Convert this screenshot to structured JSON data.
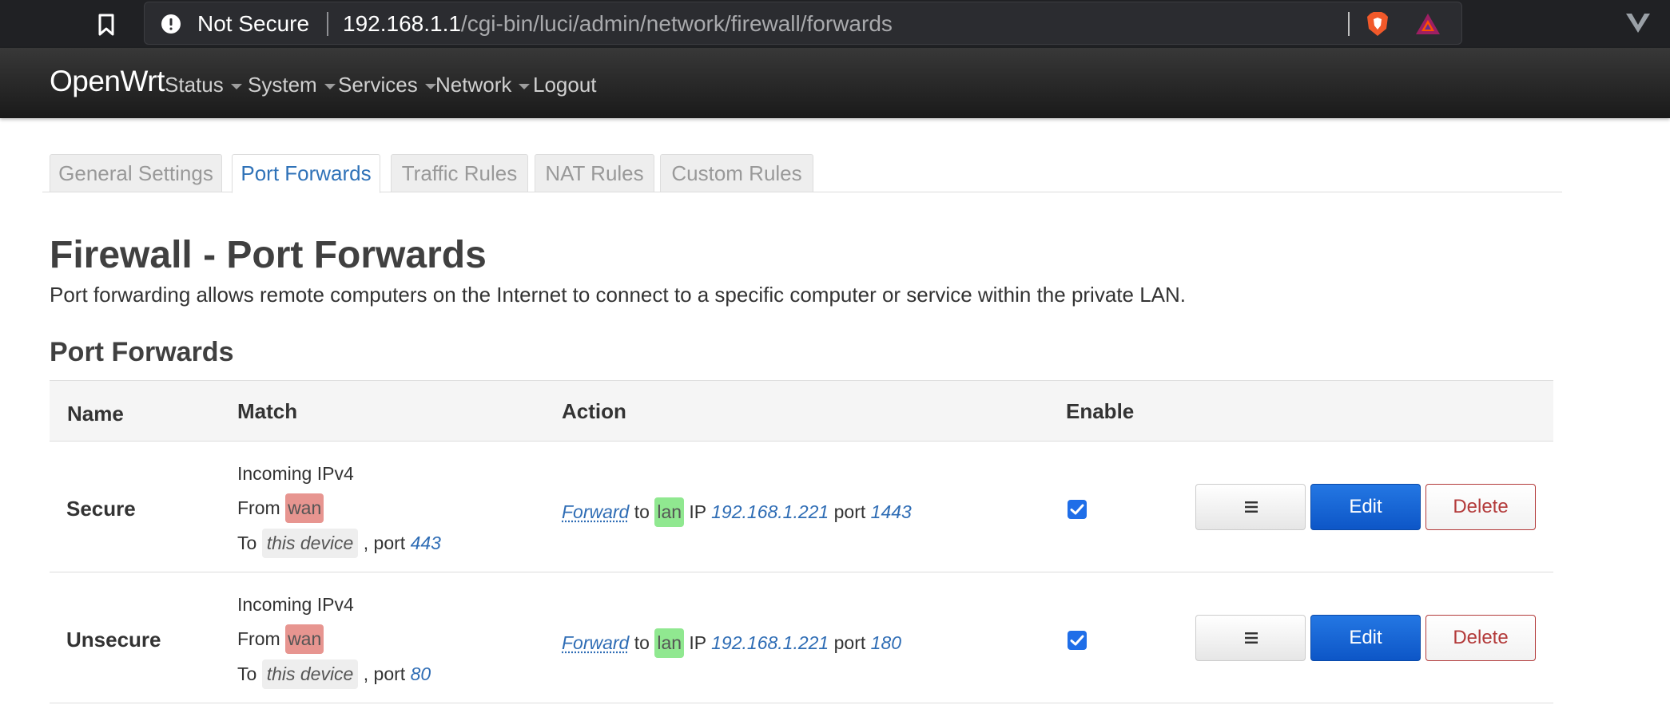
{
  "browser": {
    "security_label": "Not Secure",
    "url_host": "192.168.1.1",
    "url_path": "/cgi-bin/luci/admin/network/firewall/forwards",
    "icons": [
      "bookmark-icon",
      "warning-icon",
      "brave-shield-icon",
      "bat-rewards-icon",
      "vivaldi-icon"
    ]
  },
  "navbar": {
    "brand": "OpenWrt",
    "items": [
      "Status",
      "System",
      "Services",
      "Network",
      "Logout"
    ]
  },
  "tabs": [
    {
      "label": "General Settings",
      "active": false
    },
    {
      "label": "Port Forwards",
      "active": true
    },
    {
      "label": "Traffic Rules",
      "active": false
    },
    {
      "label": "NAT Rules",
      "active": false
    },
    {
      "label": "Custom Rules",
      "active": false
    }
  ],
  "page": {
    "title": "Firewall - Port Forwards",
    "description": "Port forwarding allows remote computers on the Internet to connect to a specific computer or service within the private LAN.",
    "section_title": "Port Forwards"
  },
  "table": {
    "headers": [
      "Name",
      "Match",
      "Action",
      "Enable"
    ],
    "rows": [
      {
        "name": "Secure",
        "match": {
          "incoming": "Incoming IPv4",
          "from_label": "From",
          "from_zone": "wan",
          "to_label": "To",
          "to_target": "this device",
          "port_label": ", port",
          "port": "443"
        },
        "action": {
          "verb": "Forward",
          "to": "to",
          "zone": "lan",
          "ip_label": "IP",
          "ip": "192.168.1.221",
          "port_label": "port",
          "port": "1443"
        },
        "enabled": true,
        "buttons": {
          "edit": "Edit",
          "delete": "Delete"
        }
      },
      {
        "name": "Unsecure",
        "match": {
          "incoming": "Incoming IPv4",
          "from_label": "From",
          "from_zone": "wan",
          "to_label": "To",
          "to_target": "this device",
          "port_label": ", port",
          "port": "80"
        },
        "action": {
          "verb": "Forward",
          "to": "to",
          "zone": "lan",
          "ip_label": "IP",
          "ip": "192.168.1.221",
          "port_label": "port",
          "port": "180"
        },
        "enabled": true,
        "buttons": {
          "edit": "Edit",
          "delete": "Delete"
        }
      }
    ]
  },
  "colors": {
    "wan_zone": "#e79590",
    "lan_zone": "#90e890",
    "primary_button": "#1f6ee8",
    "delete_text": "#b33a3a",
    "link": "#2f6db5",
    "active_tab_text": "#2f72b8"
  }
}
